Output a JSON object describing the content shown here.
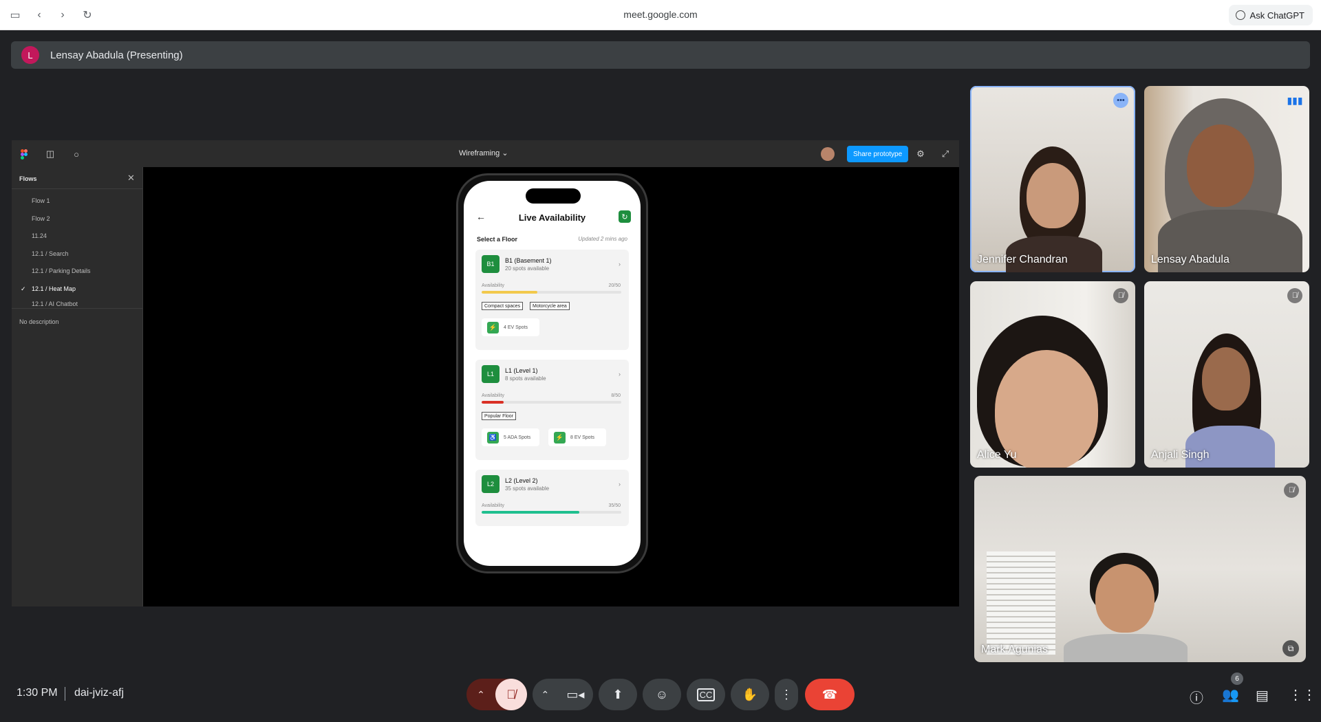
{
  "browser": {
    "url": "meet.google.com",
    "ask_label": "Ask ChatGPT"
  },
  "presenter": {
    "initial": "L",
    "label": "Lensay Abadula (Presenting)"
  },
  "figma": {
    "file_title": "Wireframing",
    "share_label": "Share prototype",
    "flows_title": "Flows",
    "flows": [
      "Flow 1",
      "Flow 2",
      "11.24",
      "12.1 / Search",
      "12.1 / Parking Details",
      "12.1 / Heat Map",
      "12.1 / AI Chatbot"
    ],
    "selected_flow": "12.1 / Heat Map",
    "no_description": "No description"
  },
  "app": {
    "title": "Live Availability",
    "select_floor": "Select a Floor",
    "updated": "Updated 2 mins ago",
    "availability_label": "Availability",
    "floors": [
      {
        "badge": "B1",
        "name": "B1 (Basement 1)",
        "sub": "20 spots available",
        "count": "20/50",
        "fraction": 0.4,
        "color": "#f2c94c",
        "tags": [
          "Compact spaces",
          "Motorcycle area"
        ],
        "chips": [
          "4 EV Spots"
        ]
      },
      {
        "badge": "L1",
        "name": "L1 (Level 1)",
        "sub": "8 spots available",
        "count": "8/50",
        "fraction": 0.16,
        "color": "#d93025",
        "tags": [
          "Popular Floor"
        ],
        "chips": [
          "5 ADA Spots",
          "8 EV Spots"
        ]
      },
      {
        "badge": "L2",
        "name": "L2 (Level 2)",
        "sub": "35 spots available",
        "count": "35/50",
        "fraction": 0.7,
        "color": "#1fbf8f",
        "tags": [],
        "chips": []
      }
    ]
  },
  "participants": [
    {
      "name": "Jennifer Chandran",
      "status": "more-options"
    },
    {
      "name": "Lensay Abadula",
      "status": "speaking"
    },
    {
      "name": "Alice Yu",
      "status": "muted"
    },
    {
      "name": "Anjali Singh",
      "status": "muted"
    },
    {
      "name": "Mark Agunias",
      "status": "muted"
    }
  ],
  "meeting": {
    "time": "1:30 PM",
    "code": "dai-jviz-afj",
    "people_count": "6"
  }
}
